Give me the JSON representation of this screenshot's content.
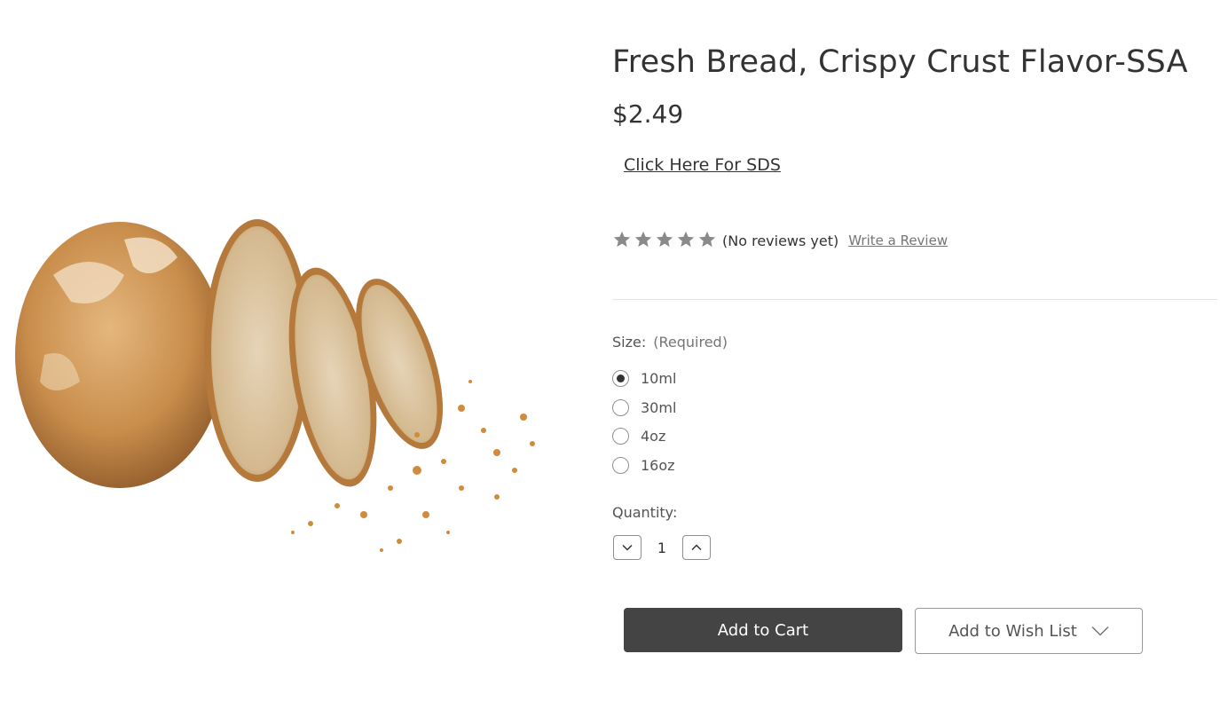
{
  "product": {
    "title": "Fresh Bread, Crispy Crust Flavor-SSA",
    "price": "$2.49",
    "sds_link": "Click Here For SDS",
    "image_alt": "Sliced crusty bread loaf with crumbs"
  },
  "rating": {
    "stars": 5,
    "reviews_text": "(No reviews yet)",
    "write_review_label": "Write a Review",
    "star_color": "#757575"
  },
  "size": {
    "label": "Size:",
    "required_text": "(Required)",
    "options": [
      "10ml",
      "30ml",
      "4oz",
      "16oz"
    ],
    "selected": "10ml"
  },
  "quantity": {
    "label": "Quantity:",
    "value": "1"
  },
  "actions": {
    "add_to_cart": "Add to Cart",
    "add_to_wishlist": "Add to Wish List"
  },
  "colors": {
    "primary_button": "#444444",
    "text": "#333333",
    "muted": "#757575"
  }
}
